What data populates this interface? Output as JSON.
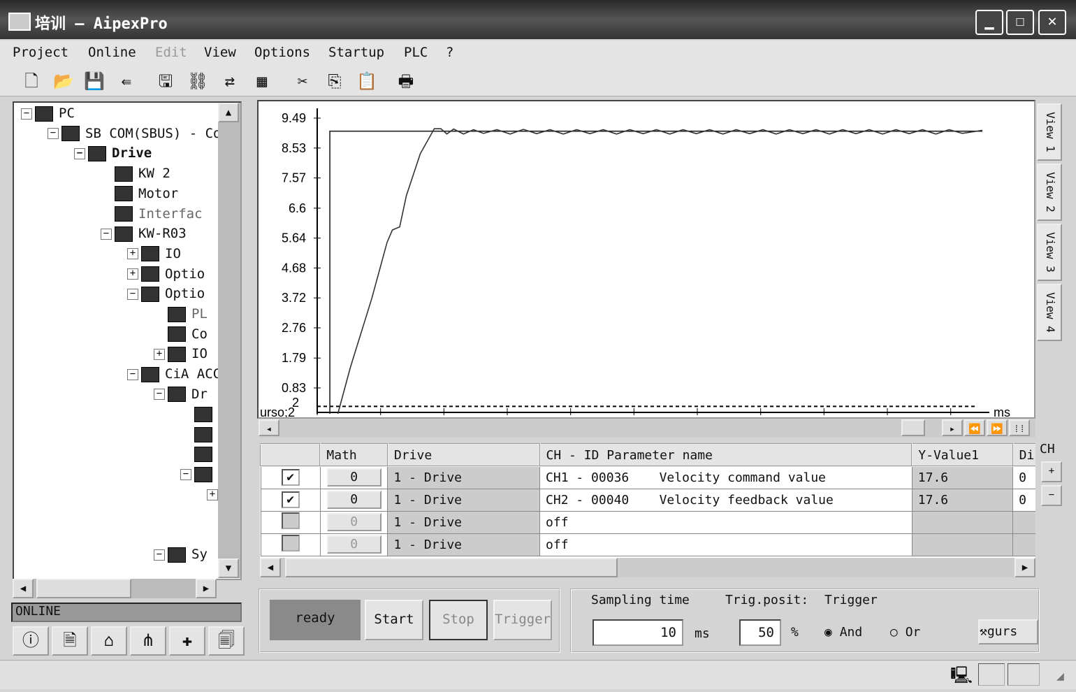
{
  "window": {
    "title": "培训 – AipexPro",
    "minimize": "▁",
    "maximize": "☐",
    "close": "✕"
  },
  "menu": [
    {
      "label": "Project"
    },
    {
      "label": "Online"
    },
    {
      "label": "Edit",
      "disabled": true
    },
    {
      "label": "View"
    },
    {
      "label": "Options"
    },
    {
      "label": "Startup"
    },
    {
      "label": "PLC"
    },
    {
      "label": "?"
    }
  ],
  "toolbar": {
    "icons": [
      "new-icon",
      "open-icon",
      "save-icon",
      "import-icon",
      "download-icon",
      "upload-icon",
      "compare-icon",
      "disabled-icon",
      "cut-icon",
      "copy-icon",
      "paste-icon",
      "print-icon"
    ],
    "glyphs": [
      "🗋",
      "📂",
      "💾",
      "⇚",
      "🖫",
      "⛓",
      "⇄",
      "▦",
      "✂",
      "⎘",
      "📋",
      "🖶"
    ]
  },
  "tree": {
    "items": [
      {
        "label": "PC",
        "level": 0,
        "toggle": "−"
      },
      {
        "label": "SB COM(SBUS) - Cor",
        "level": 1,
        "toggle": "−"
      },
      {
        "label": "Drive",
        "level": 2,
        "toggle": "−",
        "bold": true
      },
      {
        "label": "KW 2",
        "level": 3
      },
      {
        "label": "Motor",
        "level": 3
      },
      {
        "label": "Interfac",
        "level": 3,
        "dim": true
      },
      {
        "label": "KW-R03",
        "level": 3,
        "toggle": "−"
      },
      {
        "label": "IO",
        "level": 4,
        "toggle": "+"
      },
      {
        "label": "Optio",
        "level": 4,
        "toggle": "+"
      },
      {
        "label": "Optio",
        "level": 4,
        "toggle": "−"
      },
      {
        "label": "PL",
        "level": 5,
        "dim": true
      },
      {
        "label": "Co",
        "level": 5
      },
      {
        "label": "IO",
        "level": 5,
        "toggle": "+"
      },
      {
        "label": "CiA ACC -",
        "level": 4,
        "toggle": "−"
      },
      {
        "label": "Dr",
        "level": 5,
        "toggle": "−"
      },
      {
        "label": "",
        "level": 6
      },
      {
        "label": "",
        "level": 6
      },
      {
        "label": "",
        "level": 6
      },
      {
        "label": "",
        "level": 6,
        "toggle": "−"
      },
      {
        "label": "",
        "level": 7,
        "toggle": "+"
      },
      {
        "label": "",
        "level": 7
      },
      {
        "label": "",
        "level": 7
      },
      {
        "label": "Sy",
        "level": 5,
        "toggle": "−"
      }
    ]
  },
  "left_status": "ONLINE",
  "left_tabs": [
    "info-icon",
    "document-icon",
    "home-icon",
    "oscilloscope-icon",
    "plus-icon",
    "report-icon"
  ],
  "left_tab_glyphs": [
    "ⓘ",
    "🗎",
    "⌂",
    "⋔",
    "✚",
    "🗐"
  ],
  "view_tabs": [
    "View 1",
    "View 2",
    "View 3",
    "View 4"
  ],
  "chart_data": {
    "type": "line",
    "y_ticks": [
      "9.49",
      "8.53",
      "7.57",
      "6.6",
      "5.64",
      "4.68",
      "3.72",
      "2.76",
      "1.79",
      "0.83"
    ],
    "ylim": [
      0,
      9.49
    ],
    "xlim": [
      0,
      100
    ],
    "x_unit": "ms",
    "cursor_label": "urso;2",
    "cursor_value_label": "2",
    "cursor_value": 0.15,
    "series": [
      {
        "color": "#222",
        "points": [
          [
            1.9,
            0
          ],
          [
            1.9,
            9.07
          ],
          [
            100,
            9.07
          ]
        ]
      },
      {
        "color": "#333",
        "points": [
          [
            3.1,
            0
          ],
          [
            5,
            1.5
          ],
          [
            8.2,
            3.7
          ],
          [
            10.5,
            5.5
          ],
          [
            11.3,
            5.9
          ],
          [
            12.4,
            6.0
          ],
          [
            13.4,
            7.0
          ],
          [
            15.5,
            8.35
          ],
          [
            17.6,
            9.15
          ],
          [
            18.6,
            9.15
          ],
          [
            19.5,
            8.98
          ],
          [
            20.5,
            9.14
          ],
          [
            22,
            8.98
          ],
          [
            23.5,
            9.12
          ],
          [
            25,
            9.0
          ],
          [
            27,
            9.12
          ],
          [
            29,
            8.98
          ],
          [
            31,
            9.13
          ],
          [
            33,
            8.99
          ],
          [
            35,
            9.12
          ],
          [
            37,
            8.98
          ],
          [
            39,
            9.12
          ],
          [
            41,
            8.99
          ],
          [
            43,
            9.12
          ],
          [
            45,
            8.98
          ],
          [
            47,
            9.12
          ],
          [
            49,
            8.99
          ],
          [
            51,
            9.12
          ],
          [
            53,
            8.98
          ],
          [
            55,
            9.12
          ],
          [
            57,
            8.99
          ],
          [
            59,
            9.12
          ],
          [
            61,
            8.98
          ],
          [
            63,
            9.12
          ],
          [
            65,
            8.99
          ],
          [
            67,
            9.12
          ],
          [
            69,
            8.98
          ],
          [
            71,
            9.12
          ],
          [
            73,
            8.99
          ],
          [
            75,
            9.12
          ],
          [
            77,
            8.98
          ],
          [
            79,
            9.12
          ],
          [
            81,
            8.99
          ],
          [
            83,
            9.12
          ],
          [
            85,
            8.98
          ],
          [
            87,
            9.12
          ],
          [
            89,
            8.99
          ],
          [
            91,
            9.12
          ],
          [
            93,
            8.98
          ],
          [
            95,
            9.12
          ],
          [
            97,
            9.0
          ],
          [
            100,
            9.1
          ]
        ]
      }
    ]
  },
  "table": {
    "headers": [
      "",
      "Math",
      "Drive",
      "CH - ID Parameter name",
      "Y-Value1",
      "Dif"
    ],
    "rows": [
      {
        "checked": true,
        "math": "0",
        "drive": "1 - Drive",
        "param": "CH1 - 00036    Velocity command value",
        "y": "17.6",
        "dif": "0"
      },
      {
        "checked": true,
        "math": "0",
        "drive": "1 - Drive",
        "param": "CH2 - 00040    Velocity feedback value",
        "y": "17.6",
        "dif": "0"
      },
      {
        "checked": false,
        "math": "0",
        "drive": "1 - Drive",
        "param": "off",
        "y": "",
        "dif": ""
      },
      {
        "checked": false,
        "math": "0",
        "drive": "1 - Drive",
        "param": "off",
        "y": "",
        "dif": ""
      }
    ]
  },
  "ch_panel": {
    "label": "CH",
    "add": "+",
    "remove": "−"
  },
  "controls": {
    "status": "ready",
    "start": "Start",
    "stop": "Stop",
    "trigger": "Trigger",
    "sampling_label": "Sampling time",
    "trig_posit_label": "Trig.posit:",
    "trigger_label": "Trigger",
    "sampling_value": "10",
    "sampling_unit": "ms",
    "trig_value": "50",
    "trig_unit": "%",
    "and_label": "And",
    "or_label": "Or",
    "logic_selected": "And",
    "config_label": "gurs"
  }
}
